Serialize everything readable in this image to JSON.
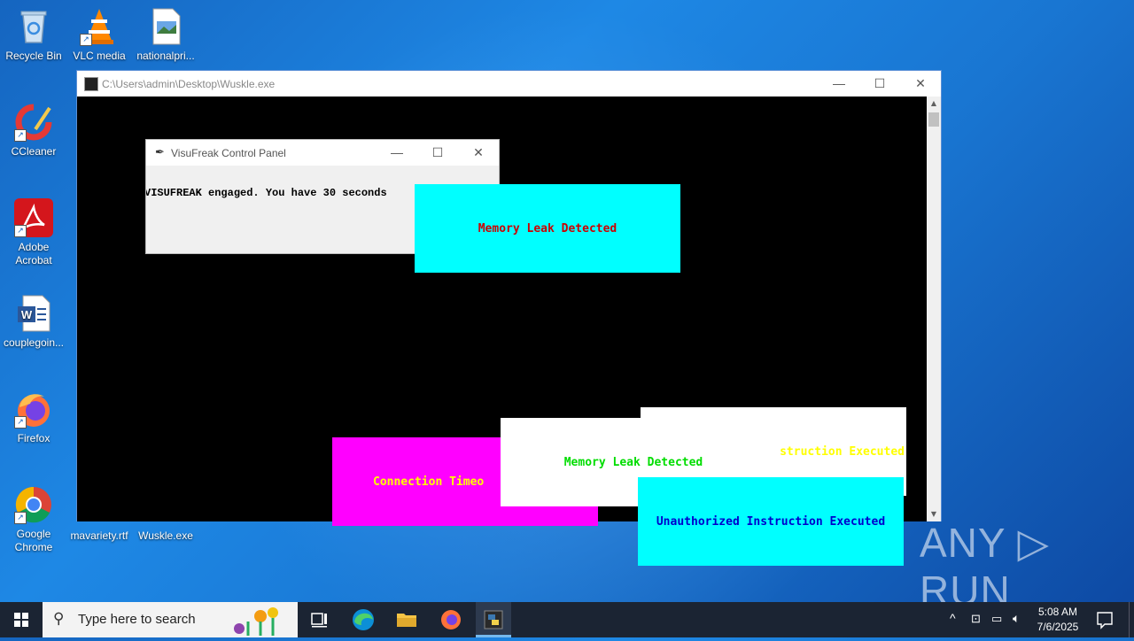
{
  "desktop": {
    "icons": [
      {
        "label": "Recycle Bin"
      },
      {
        "label": "VLC media"
      },
      {
        "label": "nationalpri..."
      },
      {
        "label": "CCleaner"
      },
      {
        "label": "Adobe Acrobat"
      },
      {
        "label": "couplegoin..."
      },
      {
        "label": "Firefox"
      },
      {
        "label": "Google Chrome"
      },
      {
        "label": "mavariety.rtf"
      },
      {
        "label": "Wuskle.exe"
      }
    ]
  },
  "console_window": {
    "title": "C:\\Users\\admin\\Desktop\\Wuskle.exe"
  },
  "control_panel": {
    "title": "VisuFreak Control Panel",
    "message": "VISUFREAK engaged. You have 30 seconds"
  },
  "popups": [
    {
      "text": "Memory Leak Detected",
      "bg": "#00ffff",
      "fg": "#cc0000"
    },
    {
      "text": "Connection Timeo",
      "bg": "#ff00ff",
      "fg": "#ffff00"
    },
    {
      "text": "Memory Leak Detected",
      "bg": "#ffffff",
      "fg": "#00dd00"
    },
    {
      "text": "struction Executed",
      "bg": "#ffffff",
      "fg": "#ffff00"
    },
    {
      "text": "Unauthorized Instruction Executed",
      "bg": "#00ffff",
      "fg": "#0000cc"
    }
  ],
  "watermark": {
    "text": "ANY ▷ RUN"
  },
  "taskbar": {
    "search_placeholder": "Type here to search",
    "time": "5:08 AM",
    "date": "7/6/2025"
  },
  "colors": {
    "taskbar": "#1b2433",
    "accent": "#76b9ed"
  }
}
